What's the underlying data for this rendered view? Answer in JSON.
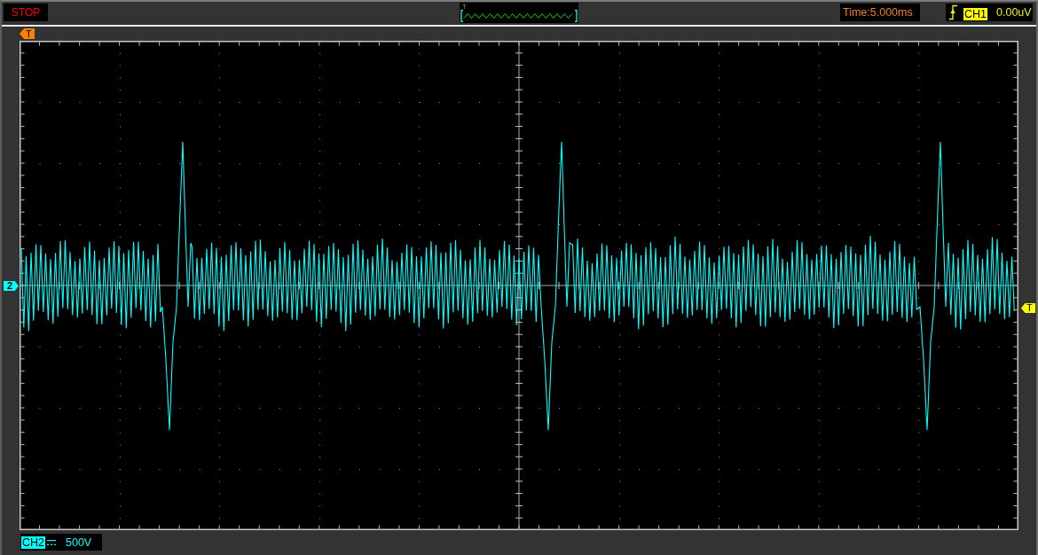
{
  "status": {
    "label": "STOP"
  },
  "overview": {
    "trigger_label": "T"
  },
  "timebase": {
    "label": "Time:5.000ms"
  },
  "trigger": {
    "rising_edge": true,
    "source": "CH1",
    "threshold": "0.00uV"
  },
  "markers": {
    "trigger_position": "T",
    "channel": "2",
    "trigger_level": "T"
  },
  "channel": {
    "name": "CH2",
    "dc_coupled": true,
    "scale": "500V"
  }
}
